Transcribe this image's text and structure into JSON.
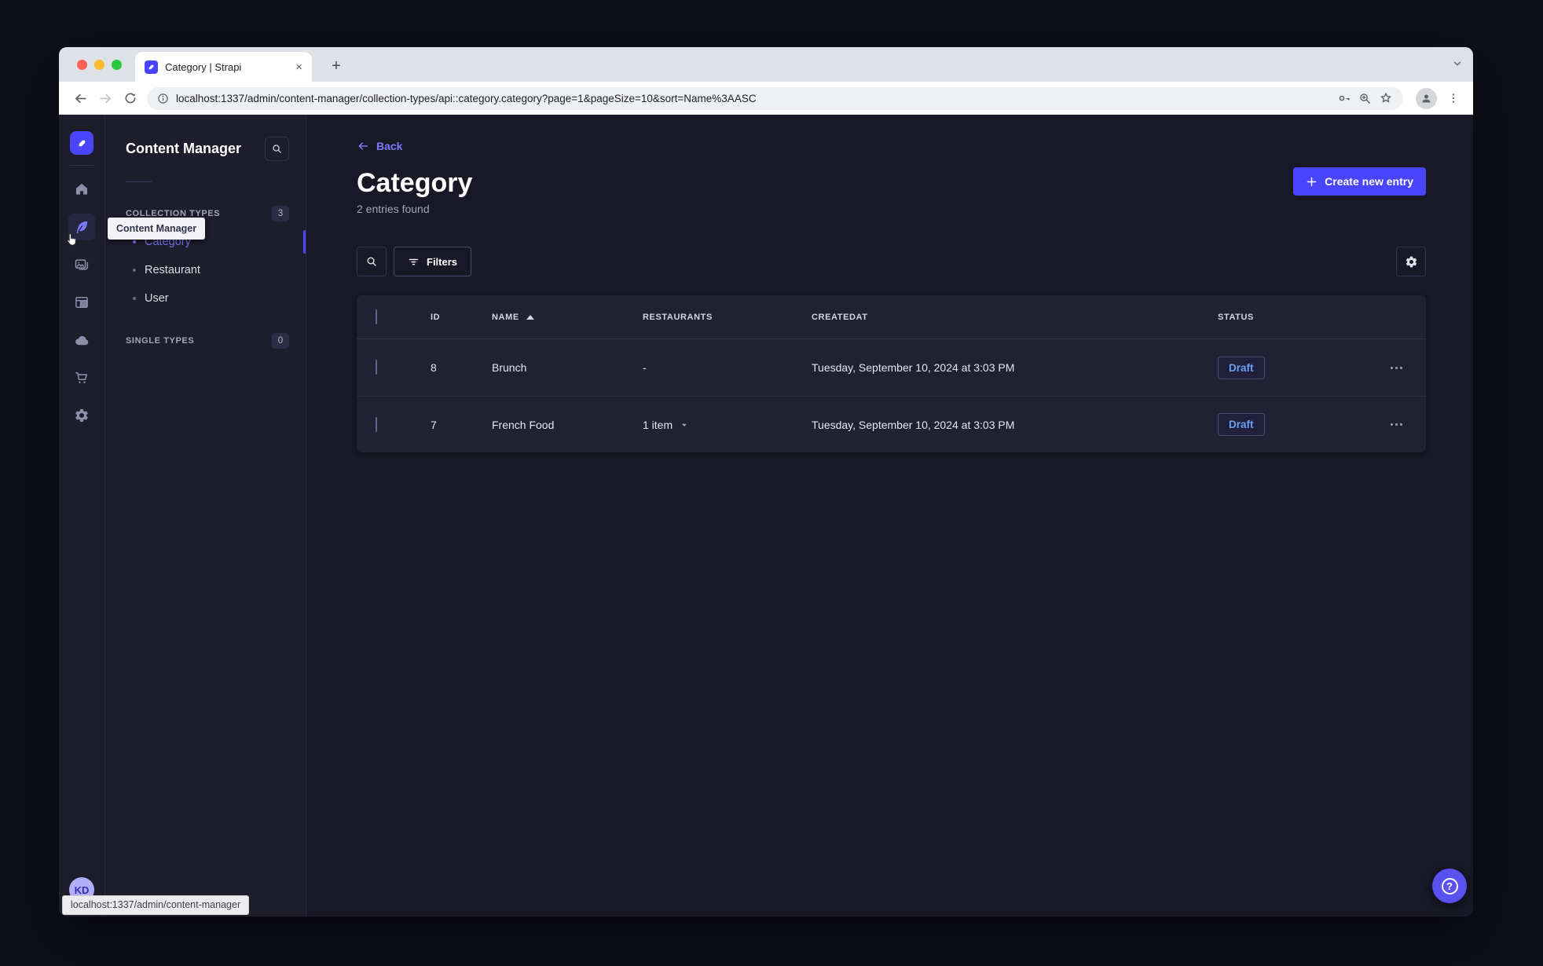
{
  "browser": {
    "tab_title": "Category | Strapi",
    "url": "localhost:1337/admin/content-manager/collection-types/api::category.category?page=1&pageSize=10&sort=Name%3AASC",
    "status_link": "localhost:1337/admin/content-manager",
    "new_tab_label": "+",
    "close_tab_label": "×"
  },
  "colors": {
    "accent": "#4945ff",
    "accent_light": "#7b79ff",
    "draft_text": "#699ff7",
    "app_background": "#181826",
    "panel_background": "#212134",
    "border": "#32324d"
  },
  "rail": {
    "icons": [
      "strapi-logo",
      "home",
      "content-manager",
      "media-library",
      "content-type-builder",
      "cloud",
      "marketplace",
      "settings"
    ],
    "active_icon": "content-manager",
    "tooltip": "Content Manager",
    "avatar_initials": "KD"
  },
  "subnav": {
    "title": "Content Manager",
    "collection_types": {
      "label": "COLLECTION TYPES",
      "count": "3",
      "items": [
        {
          "label": "Category",
          "active": true
        },
        {
          "label": "Restaurant",
          "active": false
        },
        {
          "label": "User",
          "active": false
        }
      ]
    },
    "single_types": {
      "label": "SINGLE TYPES",
      "count": "0"
    }
  },
  "main": {
    "back_label": "Back",
    "title": "Category",
    "subtitle": "2 entries found",
    "create_button": "Create new entry",
    "filters_button": "Filters",
    "table": {
      "headers": {
        "id": "ID",
        "name": "NAME",
        "restaurants": "RESTAURANTS",
        "createdat": "CREATEDAT",
        "status": "STATUS"
      },
      "rows": [
        {
          "id": "8",
          "name": "Brunch",
          "restaurants": "-",
          "createdat": "Tuesday, September 10, 2024 at 3:03 PM",
          "status": "Draft"
        },
        {
          "id": "7",
          "name": "French Food",
          "restaurants": "1 item",
          "createdat": "Tuesday, September 10, 2024 at 3:03 PM",
          "status": "Draft"
        }
      ]
    },
    "help_label": "?"
  }
}
